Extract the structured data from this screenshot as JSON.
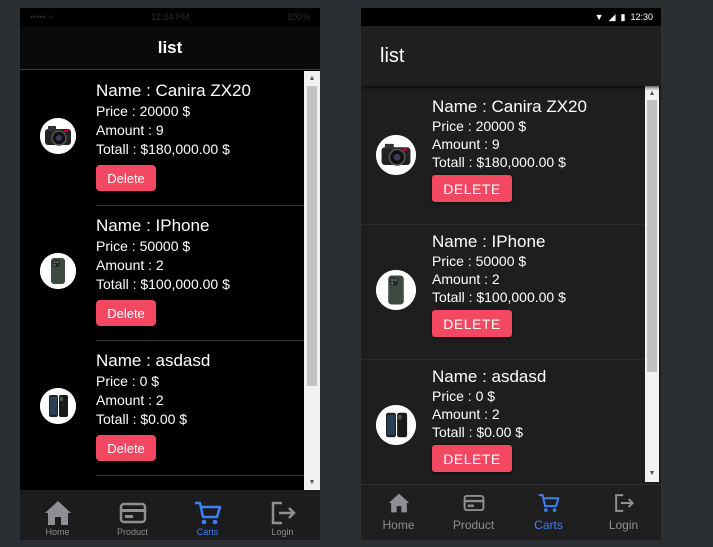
{
  "ios": {
    "status": {
      "left": "••••• ≈",
      "time": "12:34 PM",
      "battery": "100%"
    },
    "title": "list",
    "items": [
      {
        "name": "Name : Canira ZX20",
        "price": "Price : 20000 $",
        "amount": "Amount : 9",
        "total": "Totall : $180,000.00 $",
        "delete": "Delete",
        "icon": "camera-icon"
      },
      {
        "name": "Name : IPhone",
        "price": "Price : 50000 $",
        "amount": "Amount : 2",
        "total": "Totall : $100,000.00 $",
        "delete": "Delete",
        "icon": "phone-icon"
      },
      {
        "name": "Name : asdasd",
        "price": "Price : 0 $",
        "amount": "Amount : 2",
        "total": "Totall : $0.00 $",
        "delete": "Delete",
        "icon": "phone-icon"
      }
    ],
    "tabs": [
      {
        "label": "Home",
        "icon": "home-icon",
        "active": false
      },
      {
        "label": "Product",
        "icon": "card-icon",
        "active": false
      },
      {
        "label": "Carts",
        "icon": "cart-icon",
        "active": true
      },
      {
        "label": "Login",
        "icon": "logout-icon",
        "active": false
      }
    ]
  },
  "android": {
    "status": {
      "time": "12:30"
    },
    "title": "list",
    "items": [
      {
        "name": "Name : Canira ZX20",
        "price": "Price : 20000 $",
        "amount": "Amount : 9",
        "total": "Totall : $180,000.00 $",
        "delete": "DELETE",
        "icon": "camera-icon"
      },
      {
        "name": "Name : IPhone",
        "price": "Price : 50000 $",
        "amount": "Amount : 2",
        "total": "Totall : $100,000.00 $",
        "delete": "DELETE",
        "icon": "phone-icon"
      },
      {
        "name": "Name : asdasd",
        "price": "Price : 0 $",
        "amount": "Amount : 2",
        "total": "Totall : $0.00 $",
        "delete": "DELETE",
        "icon": "phone-icon"
      }
    ],
    "tabs": [
      {
        "label": "Home",
        "icon": "home-icon",
        "active": false
      },
      {
        "label": "Product",
        "icon": "card-icon",
        "active": false
      },
      {
        "label": "Carts",
        "icon": "cart-icon",
        "active": true
      },
      {
        "label": "Login",
        "icon": "logout-icon",
        "active": false
      }
    ]
  },
  "colors": {
    "accent": "#f24861",
    "active_tab": "#3b82f6",
    "inactive_tab": "#8e8e93"
  }
}
